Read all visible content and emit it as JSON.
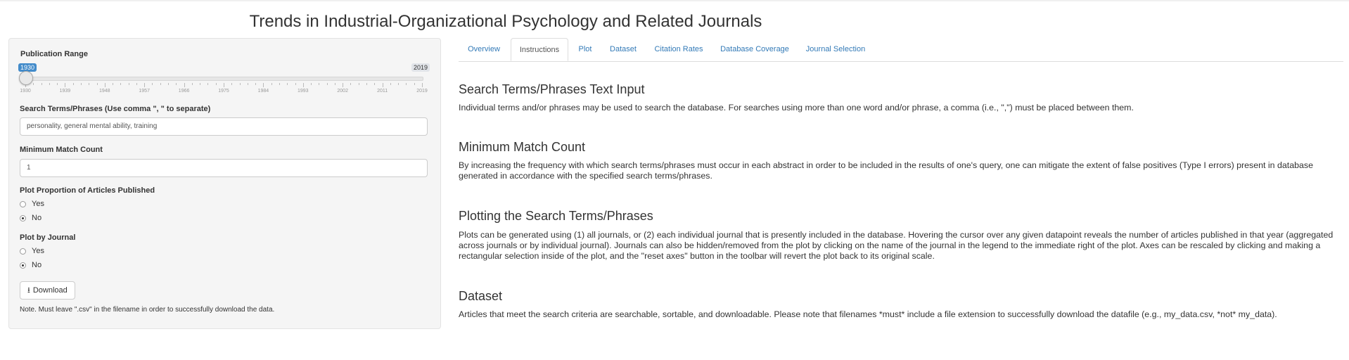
{
  "page_title": "Trends in Industrial-Organizational Psychology and Related Journals",
  "sidebar": {
    "publication_range": {
      "label": "Publication Range",
      "min_value": "1930",
      "max_value": "2019",
      "tick_labels": [
        "1930",
        "1939",
        "1948",
        "1957",
        "1966",
        "1975",
        "1984",
        "1993",
        "2002",
        "2011",
        "2019"
      ]
    },
    "search_terms": {
      "label": "Search Terms/Phrases (Use comma \", \" to separate)",
      "value": "personality, general mental ability, training"
    },
    "min_match": {
      "label": "Minimum Match Count",
      "value": "1"
    },
    "plot_proportion": {
      "label": "Plot Proportion of Articles Published",
      "options": [
        "Yes",
        "No"
      ],
      "selected": "No"
    },
    "plot_by_journal": {
      "label": "Plot by Journal",
      "options": [
        "Yes",
        "No"
      ],
      "selected": "No"
    },
    "download_label": "Download",
    "download_icon": "download-icon",
    "note": "Note. Must leave \".csv\" in the filename in order to successfully download the data."
  },
  "tabs": [
    {
      "label": "Overview",
      "active": false
    },
    {
      "label": "Instructions",
      "active": true
    },
    {
      "label": "Plot",
      "active": false
    },
    {
      "label": "Dataset",
      "active": false
    },
    {
      "label": "Citation Rates",
      "active": false
    },
    {
      "label": "Database Coverage",
      "active": false
    },
    {
      "label": "Journal Selection",
      "active": false
    }
  ],
  "sections": [
    {
      "title": "Search Terms/Phrases Text Input",
      "body": "Individual terms and/or phrases may be used to search the database. For searches using more than one word and/or phrase, a comma (i.e., \",\") must be placed between them."
    },
    {
      "title": "Minimum Match Count",
      "body": "By increasing the frequency with which search terms/phrases must occur in each abstract in order to be included in the results of one's query, one can mitigate the extent of false positives (Type I errors) present in database generated in accordance with the specified search terms/phrases."
    },
    {
      "title": "Plotting the Search Terms/Phrases",
      "body": "Plots can be generated using (1) all journals, or (2) each individual journal that is presently included in the database. Hovering the cursor over any given datapoint reveals the number of articles published in that year (aggregated across journals or by individual journal). Journals can also be hidden/removed from the plot by clicking on the name of the journal in the legend to the immediate right of the plot. Axes can be rescaled by clicking and making a rectangular selection inside of the plot, and the \"reset axes\" button in the toolbar will revert the plot back to its original scale."
    },
    {
      "title": "Dataset",
      "body": "Articles that meet the search criteria are searchable, sortable, and downloadable. Please note that filenames *must* include a file extension to successfully download the datafile (e.g., my_data.csv, *not* my_data)."
    }
  ],
  "colors": {
    "link": "#337ab7",
    "slider_accent": "#428bca"
  }
}
